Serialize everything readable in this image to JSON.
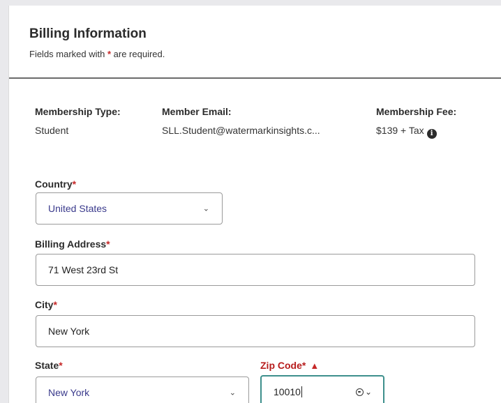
{
  "header": {
    "title": "Billing Information",
    "subtitle_pre": "Fields marked with ",
    "required_mark": "*",
    "subtitle_post": " are required."
  },
  "membership": {
    "type_label": "Membership Type:",
    "type_value": "Student",
    "email_label": "Member Email:",
    "email_value": "SLL.Student@watermarkinsights.c...",
    "fee_label": "Membership Fee:",
    "fee_value": "$139 + Tax",
    "fee_info_icon": "info-icon"
  },
  "form": {
    "country": {
      "label": "Country",
      "required": "*",
      "value": "United States"
    },
    "billing_address": {
      "label": "Billing Address",
      "required": "*",
      "value": "71 West 23rd St"
    },
    "city": {
      "label": "City",
      "required": "*",
      "value": "New York"
    },
    "state": {
      "label": "State",
      "required": "*",
      "value": "New York"
    },
    "zip": {
      "label": "Zip Code",
      "required": "*",
      "value": "10010",
      "status": "error"
    }
  },
  "colors": {
    "required": "#c62828",
    "error_label": "#b71c1c",
    "focus_border": "#3d8f8c",
    "select_text": "#3a3a8c"
  }
}
